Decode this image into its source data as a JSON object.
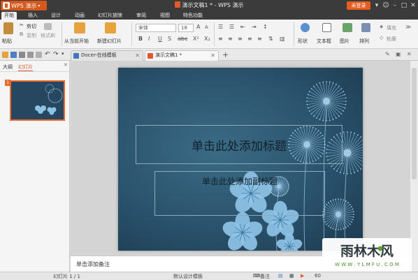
{
  "colors": {
    "accent": "#d4581c",
    "titlebar": "#3b3b3b",
    "slide_bg": "#2a526c",
    "flower": "#8ec3e6"
  },
  "titlebar": {
    "app_menu_label": "WPS 演示",
    "document_title": "演示文稿1 * - WPS 演示",
    "login_label": "未登录",
    "icons": [
      "minimize-icon",
      "maximize-icon",
      "close-icon",
      "skin-icon",
      "help-icon"
    ]
  },
  "menu": {
    "tabs": [
      "开始",
      "插入",
      "设计",
      "动画",
      "幻灯片放映",
      "审阅",
      "视图",
      "特色功能"
    ],
    "active": "开始"
  },
  "ribbon": {
    "paste": "粘贴",
    "cut": "剪切",
    "copy": "复制",
    "format_painter": "格式刷",
    "from_current": "从当前开始",
    "new_slide": "新建幻灯片",
    "font_name": "宋体",
    "font_size": "18",
    "shape": "形状",
    "textbox": "文本框",
    "picture": "图片",
    "arrange": "排列",
    "fill": "填充",
    "outline": "轮廓"
  },
  "doc_tabs": [
    {
      "label": "Docer-在线模板"
    },
    {
      "label": "演示文稿1 *"
    }
  ],
  "left_panel": {
    "tab_outline": "大纲",
    "tab_slides": "幻灯片",
    "slide_number": "1"
  },
  "slide": {
    "title_placeholder": "单击此处添加标题",
    "subtitle_placeholder": "单击此处添加副标题"
  },
  "notes": {
    "placeholder": "单击添加备注"
  },
  "status": {
    "slide_counter": "幻灯片 1 / 1",
    "template": "默认设计模板",
    "notes_toggle": "备注",
    "zoom": "60"
  },
  "watermark": {
    "brand": "雨林木风",
    "url": "W W W . Y L M F U . C O M"
  }
}
